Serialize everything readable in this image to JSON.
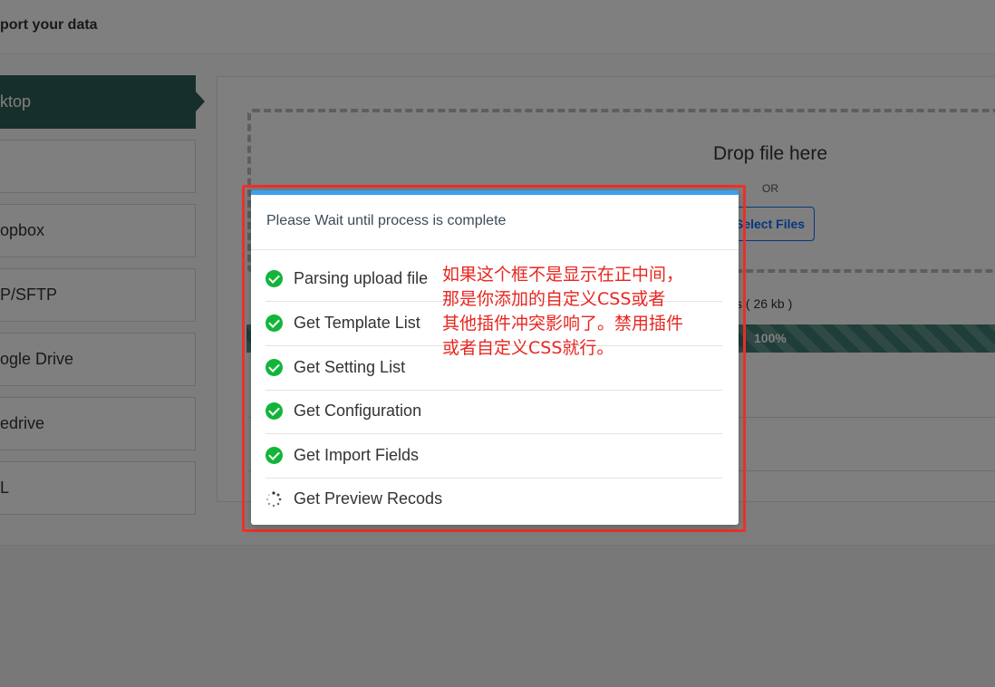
{
  "page": {
    "title": "port your data"
  },
  "sources": [
    {
      "label": "ktop",
      "active": true
    },
    {
      "label": "",
      "active": false
    },
    {
      "label": "opbox",
      "active": false
    },
    {
      "label": "P/SFTP",
      "active": false
    },
    {
      "label": "ogle Drive",
      "active": false
    },
    {
      "label": "edrive",
      "active": false
    },
    {
      "label": "L",
      "active": false
    }
  ],
  "upload": {
    "drop_title": "Drop file here",
    "or_label": "OR",
    "select_button": "Select Files",
    "file_size": "s ( 26 kb )",
    "progress_label": "100%",
    "progress_percent": 100
  },
  "modal": {
    "title": "Please Wait until process is complete",
    "steps": [
      {
        "label": "Parsing upload file",
        "status": "done"
      },
      {
        "label": "Get Template List",
        "status": "done"
      },
      {
        "label": "Get Setting List",
        "status": "done"
      },
      {
        "label": "Get Configuration",
        "status": "done"
      },
      {
        "label": "Get Import Fields",
        "status": "done"
      },
      {
        "label": "Get Preview Recods",
        "status": "loading"
      }
    ]
  },
  "annotation": {
    "lines": [
      "如果这个框不是显示在正中间，",
      "那是你添加的自定义CSS或者",
      "其他插件冲突影响了。禁用插件",
      "或者自定义CSS就行。"
    ]
  },
  "colors": {
    "accent": "#3aa0f0",
    "success": "#12b53a",
    "sidebar_active": "#2f5e57",
    "highlight_frame": "#f0302a",
    "annotation": "#e8261f",
    "link": "#0d6efd"
  }
}
